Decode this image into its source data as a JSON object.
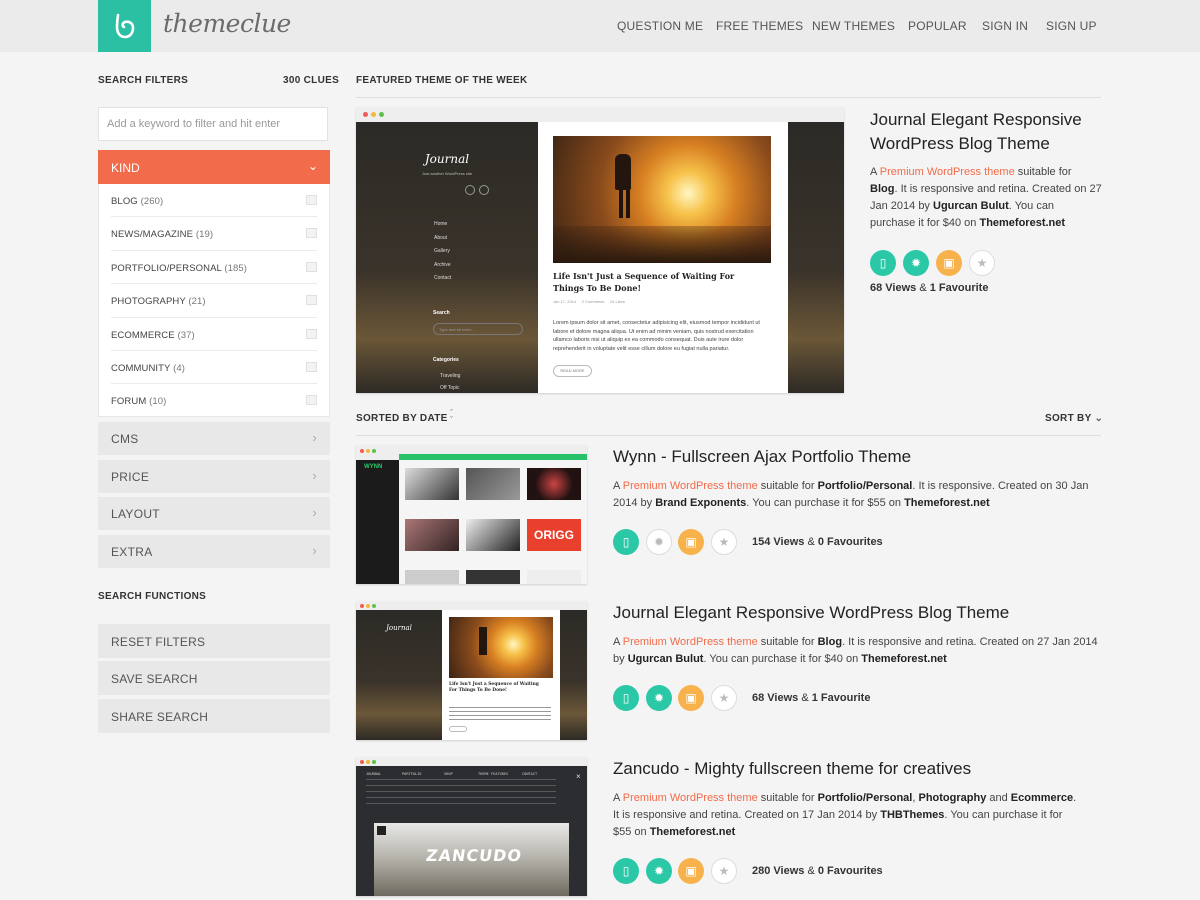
{
  "brand": "themeclue",
  "nav": [
    "QUESTION ME",
    "FREE THEMES",
    "NEW THEMES",
    "POPULAR",
    "SIGN IN",
    "SIGN UP"
  ],
  "sidebar": {
    "title": "SEARCH FILTERS",
    "clues": "300 CLUES",
    "search_placeholder": "Add a keyword to filter and hit enter",
    "kind_label": "KIND",
    "kind_items": [
      {
        "label": "BLOG",
        "count": "(260)"
      },
      {
        "label": "NEWS/MAGAZINE",
        "count": "(19)"
      },
      {
        "label": "PORTFOLIO/PERSONAL",
        "count": "(185)"
      },
      {
        "label": "PHOTOGRAPHY",
        "count": "(21)"
      },
      {
        "label": "ECOMMERCE",
        "count": "(37)"
      },
      {
        "label": "COMMUNITY",
        "count": "(4)"
      },
      {
        "label": "FORUM",
        "count": "(10)"
      }
    ],
    "filters": [
      "CMS",
      "PRICE",
      "LAYOUT",
      "EXTRA"
    ],
    "functions_title": "SEARCH FUNCTIONS",
    "functions": [
      "RESET FILTERS",
      "SAVE SEARCH",
      "SHARE SEARCH"
    ]
  },
  "featured": {
    "heading": "FEATURED THEME OF THE WEEK",
    "title": "Journal Elegant Responsive WordPress Blog Theme",
    "desc": {
      "a": "A ",
      "link1": "Premium WordPress theme",
      "b": " suitable for ",
      "kind": "Blog",
      "c": ". It is responsive and retina. Created on 27 Jan 2014 by ",
      "author": "Ugurcan Bulut",
      "d": ". You can purchase it for $40 on ",
      "store": "Themeforest.net"
    },
    "views": "68 Views",
    "amp": "&",
    "favs": "1 Favourite",
    "preview": {
      "logo": "Journal",
      "tagline": "Just another WordPress site",
      "menu": [
        "Home",
        "About",
        "Gallery",
        "Archive",
        "Contact"
      ],
      "search_label": "Search",
      "search_placeholder": "Type and hit enter...",
      "categories_label": "Categories",
      "categories": [
        "Traveling",
        "Off Topic"
      ],
      "post_title": "Life Isn't Just a Sequence of Waiting For Things To Be Done!",
      "post_meta": "Jan 17, 2014     2 Comments     24 Likes",
      "post_text": "Lorem ipsum dolor sit amet, consectetur adipisicing elit, eiusmod tempor incididunt ut labore et dolore magna aliqua. Ut enim ad minim veniam, quis nostrud exercitation ullamco laboris nisi ut aliquip ex ea commodo consequat. Duis aute irure dolor reprehenderit in voluptate velit esse cillum dolore eu fugiat nulla pariatur.",
      "read_more": "READ MORE"
    }
  },
  "list": {
    "sorted_by": "SORTED BY DATE",
    "sort_by": "SORT BY",
    "items": [
      {
        "title": "Wynn - Fullscreen Ajax Portfolio Theme",
        "a": "A ",
        "link1": "Premium WordPress theme",
        "b": " suitable for ",
        "kind": "Portfolio/Personal",
        "c": ". It is responsive. Created on 30 Jan 2014 by ",
        "author": "Brand Exponents",
        "d": ". You can purchase it for $55 on ",
        "store": "Themeforest.net",
        "views": "154 Views",
        "amp": "&",
        "favs": "0 Favourites",
        "thumb_logo": "WYNN",
        "thumb_origg": "ORIGG"
      },
      {
        "title": "Journal Elegant Responsive WordPress Blog Theme",
        "a": "A ",
        "link1": "Premium WordPress theme",
        "b": " suitable for ",
        "kind": "Blog",
        "c": ". It is responsive and retina. Created on 27 Jan 2014 by ",
        "author": "Ugurcan Bulut",
        "d": ". You can purchase it for $40 on ",
        "store": "Themeforest.net",
        "views": "68 Views",
        "amp": "&",
        "favs": "1 Favourite",
        "thumb_logo": "Journal",
        "thumb_post": "Life Isn't Just a Sequence of Waiting For Things To Be Done!"
      },
      {
        "title": "Zancudo - Mighty fullscreen theme for creatives",
        "a": "A ",
        "link1": "Premium WordPress theme",
        "b": " suitable for ",
        "kind": "Portfolio/Personal",
        "sep": ", ",
        "kind2": "Photography",
        "and": " and ",
        "kind3": "Ecommerce",
        "c": ". It is responsive and retina. Created on 17 Jan 2014 by ",
        "author": "THBThemes",
        "d": ". You can purchase it for $55 on ",
        "store": "Themeforest.net",
        "views": "280 Views",
        "amp": "&",
        "favs": "0 Favourites",
        "thumb_logo": "ZANCUDO",
        "thumb_menu": [
          "JOURNAL",
          "PORTFOLIO",
          "SHOP",
          "THEME FEATURES",
          "CONTACT"
        ]
      }
    ]
  },
  "colors": {
    "accent": "#2bbfa4",
    "orange": "#f26b4a",
    "link": "#1fa6c9",
    "yellow": "#f7b24c"
  }
}
